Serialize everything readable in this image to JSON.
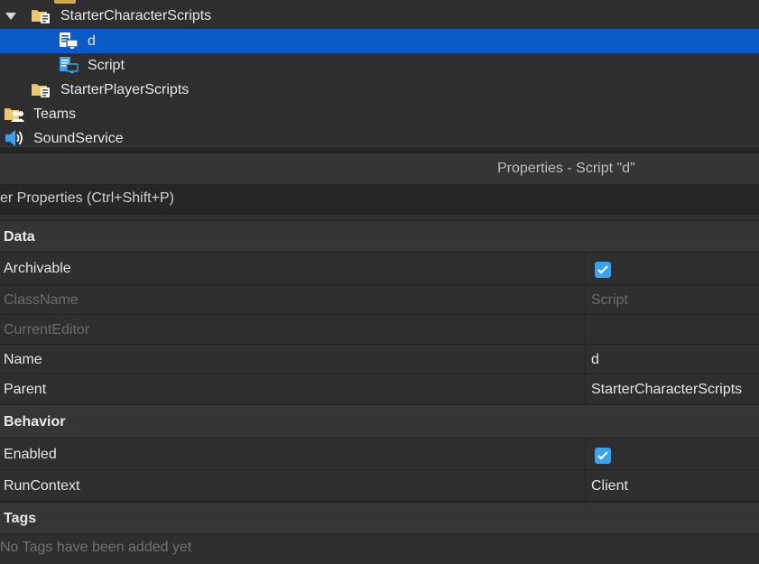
{
  "explorer": {
    "items": [
      {
        "label": "StarterCharacterScripts",
        "icon": "folder-scripts-icon",
        "expanded": true
      },
      {
        "label": "d",
        "icon": "local-script-icon",
        "selected": true
      },
      {
        "label": "Script",
        "icon": "local-script-icon"
      },
      {
        "label": "StarterPlayerScripts",
        "icon": "folder-scripts-icon"
      },
      {
        "label": "Teams",
        "icon": "teams-icon"
      },
      {
        "label": "SoundService",
        "icon": "sound-service-icon"
      }
    ]
  },
  "properties": {
    "title": "Properties - Script \"d\"",
    "filter_placeholder": "er Properties (Ctrl+Shift+P)",
    "sections": {
      "data": {
        "label": "Data",
        "rows": {
          "archivable": {
            "name": "Archivable",
            "checked": true
          },
          "classname": {
            "name": "ClassName",
            "value": "Script"
          },
          "currenteditor": {
            "name": "CurrentEditor",
            "value": ""
          },
          "name": {
            "name": "Name",
            "value": "d"
          },
          "parent": {
            "name": "Parent",
            "value": "StarterCharacterScripts"
          }
        }
      },
      "behavior": {
        "label": "Behavior",
        "rows": {
          "enabled": {
            "name": "Enabled",
            "checked": true
          },
          "runcontext": {
            "name": "RunContext",
            "value": "Client"
          }
        }
      },
      "tags": {
        "label": "Tags",
        "empty_text": "No Tags have been added yet"
      }
    }
  },
  "colors": {
    "selection": "#0b5ac9",
    "checkbox": "#35a4f2",
    "folder": "#e0b35a",
    "script_icon": "#3aa0ee"
  }
}
